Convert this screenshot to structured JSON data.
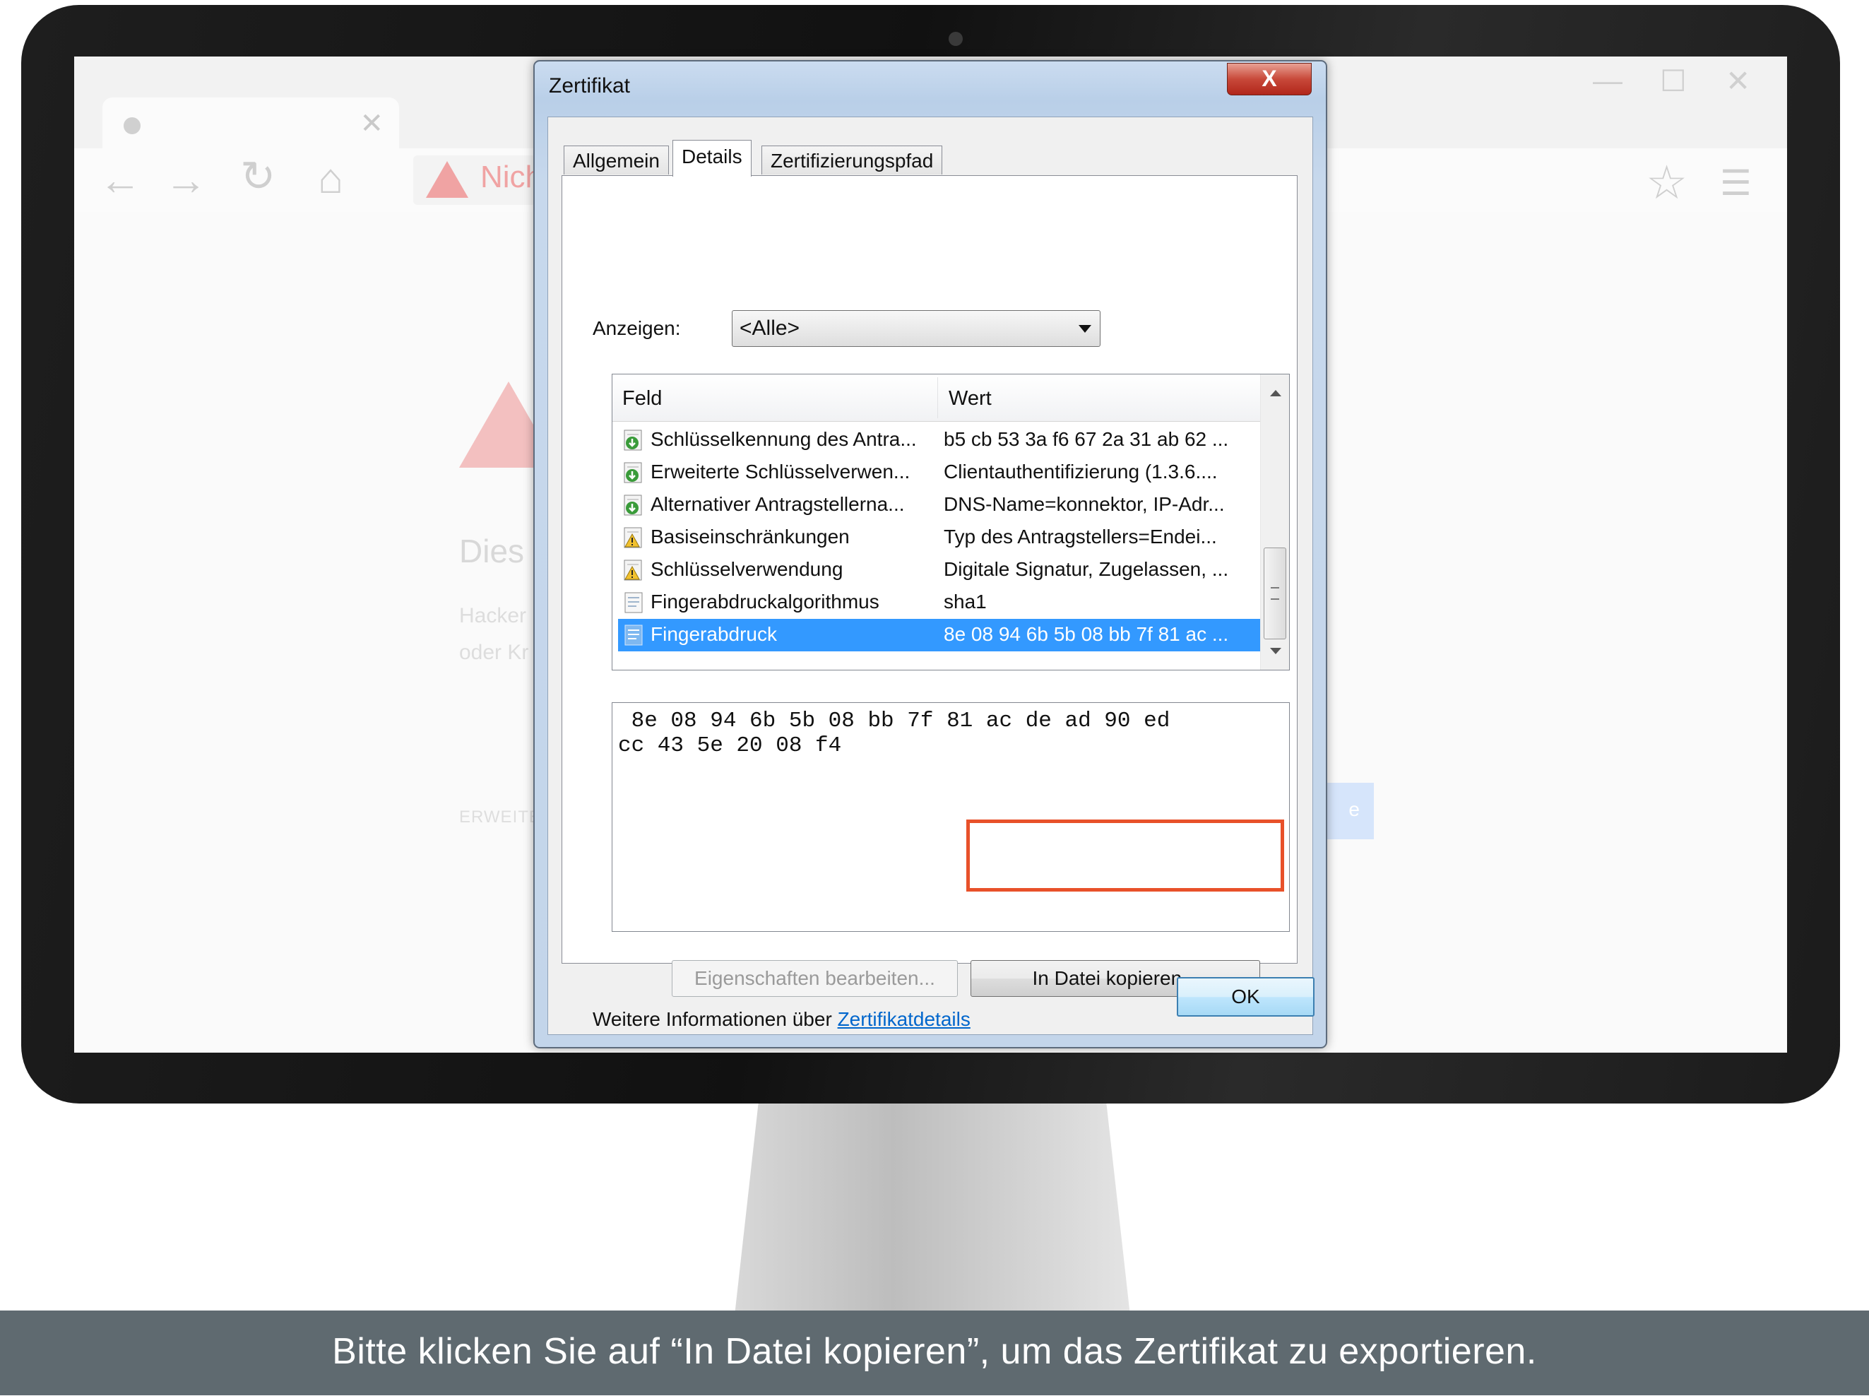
{
  "browser": {
    "address_warning": "Nich",
    "heading": "Dies",
    "body_line_1": "Hacker",
    "body_line_2": "oder Kr",
    "advanced_label": "ERWEITE",
    "button_fragment": "e"
  },
  "dialog": {
    "title": "Zertifikat",
    "close_glyph": "X",
    "tabs": [
      {
        "label": "Allgemein",
        "active": false
      },
      {
        "label": "Details",
        "active": true
      },
      {
        "label": "Zertifizierungspfad",
        "active": false
      }
    ],
    "show_label": "Anzeigen:",
    "show_value": "<Alle>",
    "list": {
      "columns": [
        "Feld",
        "Wert"
      ],
      "rows": [
        {
          "field": "Schlüsselkennung des Antra...",
          "value": "b5 cb 53 3a f6 67 2a 31 ab 62 ...",
          "icon": "extension-green-icon"
        },
        {
          "field": "Erweiterte Schlüsselverwen...",
          "value": "Clientauthentifizierung (1.3.6....",
          "icon": "extension-green-icon"
        },
        {
          "field": "Alternativer Antragstellerna...",
          "value": "DNS-Name=konnektor, IP-Adr...",
          "icon": "extension-green-icon"
        },
        {
          "field": "Basiseinschränkungen",
          "value": "Typ des Antragstellers=Endei...",
          "icon": "warning-certificate-icon"
        },
        {
          "field": "Schlüsselverwendung",
          "value": "Digitale Signatur, Zugelassen, ...",
          "icon": "warning-certificate-icon"
        },
        {
          "field": "Fingerabdruckalgorithmus",
          "value": "sha1",
          "icon": "document-property-icon"
        },
        {
          "field": "Fingerabdruck",
          "value": "8e 08 94 6b 5b 08 bb 7f 81 ac ...",
          "icon": "document-property-icon",
          "selected": true
        }
      ]
    },
    "detail_lines": [
      " 8e 08 94 6b 5b 08 bb 7f 81 ac de ad 90 ed",
      "cc 43 5e 20 08 f4"
    ],
    "edit_properties_label": "Eigenschaften bearbeiten...",
    "copy_to_file_label": "In Datei kopieren...",
    "info_text": "Weitere Informationen über ",
    "info_link": "Zertifikatdetails",
    "ok_label": "OK"
  },
  "caption": "Bitte klicken Sie auf “In Datei kopieren”, um das Zertifikat zu exportieren.",
  "colors": {
    "highlight": "#e8512a",
    "selection": "#3399ff",
    "caption_bar": "#5f6a70",
    "link": "#0066cc"
  }
}
